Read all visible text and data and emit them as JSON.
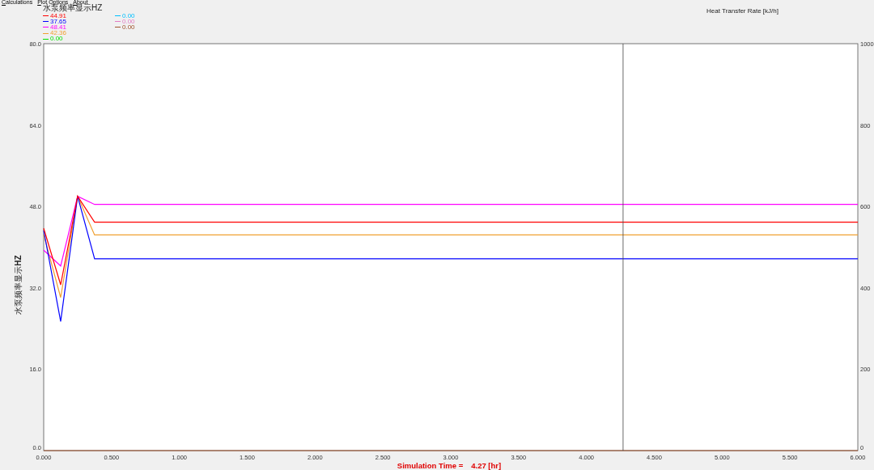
{
  "menu": [
    {
      "label": "Calculations"
    },
    {
      "label": "Plot Options"
    },
    {
      "label": "About"
    }
  ],
  "legend_title": "水泵频率显示HZ",
  "legend": [
    {
      "reading": "44.91",
      "color": "#ff0000"
    },
    {
      "reading": "37.65",
      "color": "#0000ff"
    },
    {
      "reading": "48.41",
      "color": "#ff00ff"
    },
    {
      "reading": "42.36",
      "color": "#f0a030"
    },
    {
      "reading": "0.00",
      "color": "#00e000"
    },
    {
      "reading": "0.00",
      "color": "#00bfff"
    },
    {
      "reading": "0.00",
      "color": "#e27cc4"
    },
    {
      "reading": "0.00",
      "color": "#a0522d"
    }
  ],
  "right_axis": {
    "title": "Heat Transfer Rate [kJ/h]",
    "ticks": [
      "1000",
      "800",
      "600",
      "400",
      "200",
      "0"
    ]
  },
  "chart_data": {
    "type": "line",
    "ylabel": "水泵频率显示**HZ**",
    "x": [
      0,
      0.125,
      0.25,
      0.375,
      6
    ],
    "xlim": [
      0,
      6
    ],
    "ylim": [
      0,
      80
    ],
    "xticks": [
      {
        "value": 0,
        "label": "0.000"
      },
      {
        "value": 0.5,
        "label": "0.500"
      },
      {
        "value": 1,
        "label": "1.000"
      },
      {
        "value": 1.5,
        "label": "1.500"
      },
      {
        "value": 2,
        "label": "2.000"
      },
      {
        "value": 2.5,
        "label": "2.500"
      },
      {
        "value": 3,
        "label": "3.000"
      },
      {
        "value": 3.5,
        "label": "3.500"
      },
      {
        "value": 4,
        "label": "4.000"
      },
      {
        "value": 4.5,
        "label": "4.500"
      },
      {
        "value": 5,
        "label": "5.000"
      },
      {
        "value": 5.5,
        "label": "5.500"
      },
      {
        "value": 6,
        "label": "6.000"
      }
    ],
    "yticks": [
      {
        "value": 0,
        "label": "0.0"
      },
      {
        "value": 16,
        "label": "16.0"
      },
      {
        "value": 32,
        "label": "32.0"
      },
      {
        "value": 48,
        "label": "48.0"
      },
      {
        "value": 64,
        "label": "64.0"
      },
      {
        "value": 80,
        "label": "80.0"
      }
    ],
    "series": [
      {
        "color": "#ff0000",
        "values": [
          43.7,
          32.6,
          50,
          44.9,
          44.9
        ]
      },
      {
        "color": "#0000ff",
        "values": [
          43.3,
          25.4,
          50,
          37.7,
          37.7
        ]
      },
      {
        "color": "#ff00ff",
        "values": [
          39.4,
          36.3,
          50,
          48.4,
          48.4
        ]
      },
      {
        "color": "#f0a030",
        "values": [
          42.5,
          30.1,
          50,
          42.4,
          42.4
        ]
      },
      {
        "color": "#a0522d",
        "values": [
          0,
          0,
          0,
          0,
          0
        ]
      }
    ],
    "ref_lines": [
      {
        "axis": "x",
        "value": 4.27
      }
    ]
  },
  "status": {
    "label": "Simulation Time =",
    "value": "4.27 [hr]"
  }
}
